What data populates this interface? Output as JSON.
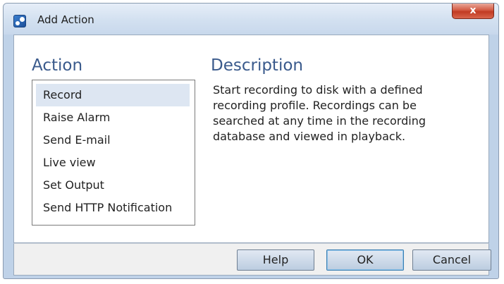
{
  "window": {
    "title": "Add Action",
    "close_symbol": "x",
    "app_icon": "app-logo-icon"
  },
  "action_panel": {
    "heading": "Action",
    "items": [
      {
        "label": "Record",
        "selected": true
      },
      {
        "label": "Raise Alarm",
        "selected": false
      },
      {
        "label": "Send E-mail",
        "selected": false
      },
      {
        "label": "Live view",
        "selected": false
      },
      {
        "label": "Set Output",
        "selected": false
      },
      {
        "label": "Send HTTP Notification",
        "selected": false
      }
    ]
  },
  "description_panel": {
    "heading": "Description",
    "text": "Start recording to disk with a defined recording profile. Recordings can be searched at any time in the recording database and viewed in playback."
  },
  "buttons": {
    "help_label": "Help",
    "ok_label": "OK",
    "cancel_label": "Cancel"
  },
  "colors": {
    "heading": "#3a5a8c",
    "selection": "#dde6f2",
    "close_button": "#c13a22"
  }
}
